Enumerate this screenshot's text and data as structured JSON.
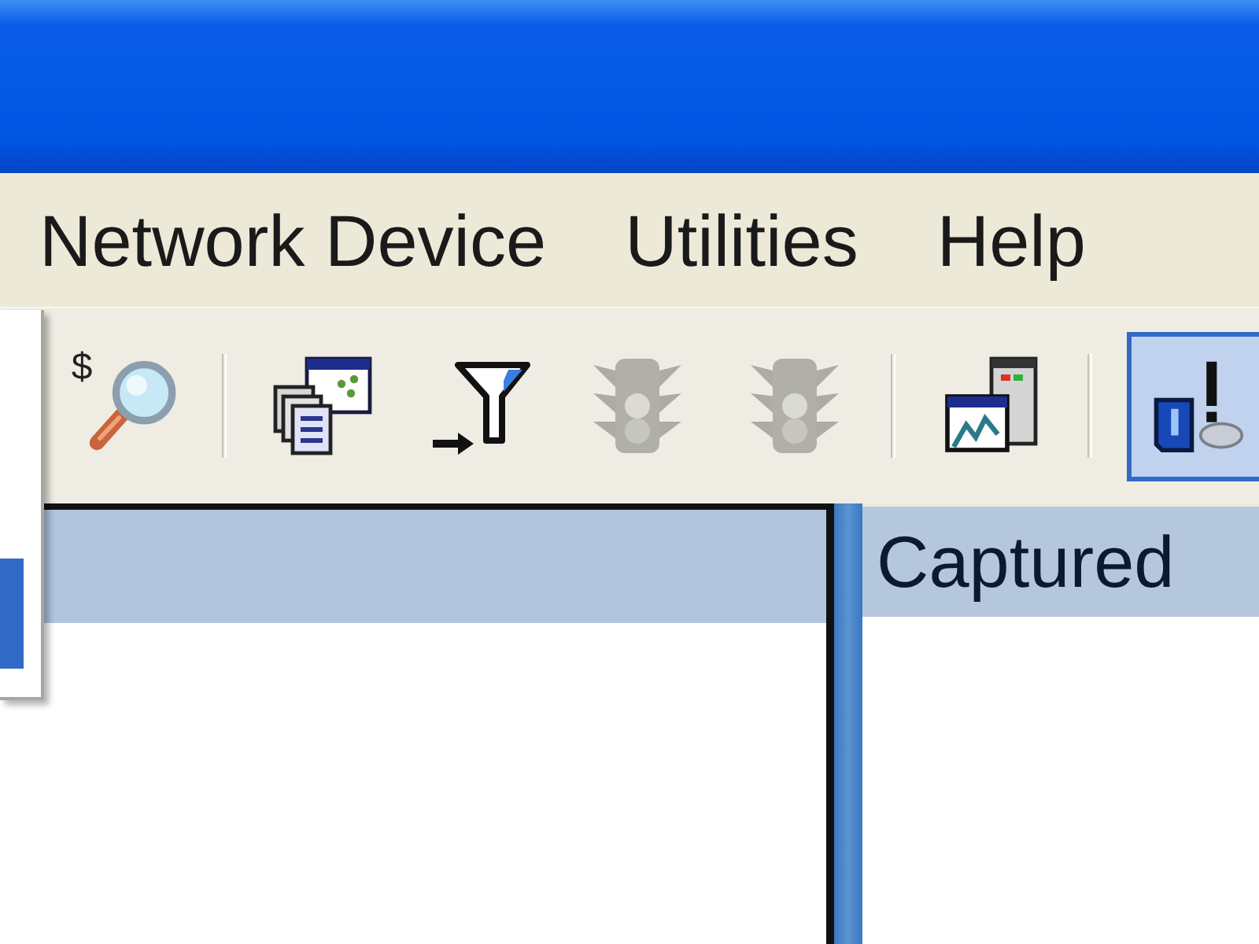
{
  "menu_bar": [
    {
      "label": "Network Device"
    },
    {
      "label": "Utilities"
    },
    {
      "label": "Help"
    }
  ],
  "dropdown_menu": {
    "items": [
      {
        "selected": true
      }
    ]
  },
  "toolbar": [
    {
      "kind": "button",
      "label": "$",
      "disabled": false,
      "pressed": false
    },
    {
      "kind": "separator"
    },
    {
      "kind": "button",
      "disabled": false,
      "pressed": false
    },
    {
      "kind": "button",
      "disabled": false,
      "pressed": false
    },
    {
      "kind": "button",
      "disabled": true,
      "pressed": false
    },
    {
      "kind": "button",
      "disabled": true,
      "pressed": false
    },
    {
      "kind": "separator"
    },
    {
      "kind": "button",
      "disabled": false,
      "pressed": false
    },
    {
      "kind": "separator"
    },
    {
      "kind": "button",
      "disabled": false,
      "pressed": true
    }
  ],
  "right_pane": {
    "header": "Captured"
  }
}
